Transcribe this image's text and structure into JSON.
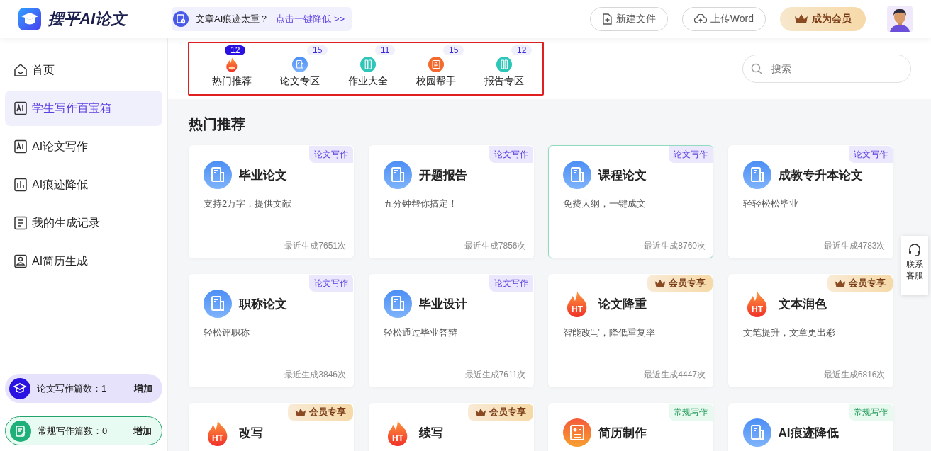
{
  "header": {
    "logo_text": "摆平AI论文",
    "notice": {
      "text": "文章AI痕迹太重？",
      "link": "点击一键降低 >>"
    },
    "buttons": [
      {
        "kind": "new",
        "label": "新建文件"
      },
      {
        "kind": "upload",
        "label": "上传Word"
      },
      {
        "kind": "vip",
        "label": "成为会员"
      }
    ]
  },
  "sidebar": {
    "items": [
      {
        "kind": "home",
        "label": "首页",
        "selected": false
      },
      {
        "kind": "ai",
        "label": "学生写作百宝箱",
        "selected": true
      },
      {
        "kind": "ai",
        "label": "AI论文写作",
        "selected": false
      },
      {
        "kind": "chart",
        "label": "AI痕迹降低",
        "selected": false
      },
      {
        "kind": "list",
        "label": "我的生成记录",
        "selected": false
      },
      {
        "kind": "person",
        "label": "AI简历生成",
        "selected": false
      }
    ],
    "counters": [
      {
        "kind": "paper",
        "label": "论文写作篇数：1",
        "action": "增加"
      },
      {
        "kind": "regular",
        "label": "常规写作篇数：0",
        "action": "增加"
      }
    ]
  },
  "tabs": [
    {
      "kind": "fire",
      "label": "热门推荐",
      "count": "12",
      "selected": true
    },
    {
      "kind": "doc",
      "label": "论文专区",
      "count": "15",
      "selected": false
    },
    {
      "kind": "ruler",
      "label": "作业大全",
      "count": "11",
      "selected": false
    },
    {
      "kind": "note",
      "label": "校园帮手",
      "count": "15",
      "selected": false
    },
    {
      "kind": "ruler",
      "label": "报告专区",
      "count": "12",
      "selected": false
    }
  ],
  "search": {
    "placeholder": "搜索"
  },
  "section_title": "热门推荐",
  "cards": [
    {
      "kind": "doc",
      "title": "毕业论文",
      "desc": "支持2万字，提供文献",
      "stat": "最近生成7651次",
      "tag": {
        "kind": "paper",
        "label": "论文写作"
      },
      "highlighted": false
    },
    {
      "kind": "doc",
      "title": "开题报告",
      "desc": "五分钟帮你搞定！",
      "stat": "最近生成7856次",
      "tag": {
        "kind": "paper",
        "label": "论文写作"
      },
      "highlighted": false
    },
    {
      "kind": "doc",
      "title": "课程论文",
      "desc": "免费大纲，一键成文",
      "stat": "最近生成8760次",
      "tag": {
        "kind": "paper",
        "label": "论文写作"
      },
      "highlighted": true
    },
    {
      "kind": "doc",
      "title": "成教专升本论文",
      "desc": "轻轻松松毕业",
      "stat": "最近生成4783次",
      "tag": {
        "kind": "paper",
        "label": "论文写作"
      },
      "highlighted": false
    },
    {
      "kind": "doc",
      "title": "职称论文",
      "desc": "轻松评职称",
      "stat": "最近生成3846次",
      "tag": {
        "kind": "paper",
        "label": "论文写作"
      },
      "highlighted": false
    },
    {
      "kind": "doc",
      "title": "毕业设计",
      "desc": "轻松通过毕业答辩",
      "stat": "最近生成7611次",
      "tag": {
        "kind": "paper",
        "label": "论文写作"
      },
      "highlighted": false
    },
    {
      "kind": "fire",
      "icon_label": "HT",
      "title": "论文降重",
      "desc": "智能改写，降低重复率",
      "stat": "最近生成4447次",
      "tag": {
        "kind": "vip",
        "label": "会员专享"
      },
      "highlighted": false
    },
    {
      "kind": "fire",
      "icon_label": "HT",
      "title": "文本润色",
      "desc": "文笔提升，文章更出彩",
      "stat": "最近生成6816次",
      "tag": {
        "kind": "vip",
        "label": "会员专享"
      },
      "highlighted": false
    },
    {
      "kind": "fire",
      "icon_label": "HT",
      "title": "改写",
      "tag": {
        "kind": "vip",
        "label": "会员专享"
      },
      "highlighted": false
    },
    {
      "kind": "fire",
      "icon_label": "HT",
      "title": "续写",
      "tag": {
        "kind": "vip",
        "label": "会员专享"
      },
      "highlighted": false
    },
    {
      "kind": "resume",
      "title": "简历制作",
      "tag": {
        "kind": "regular",
        "label": "常规写作"
      },
      "highlighted": false
    },
    {
      "kind": "doc",
      "title": "AI痕迹降低",
      "tag": {
        "kind": "regular",
        "label": "常规写作"
      },
      "highlighted": false
    }
  ],
  "support": {
    "label": "联系客服"
  }
}
